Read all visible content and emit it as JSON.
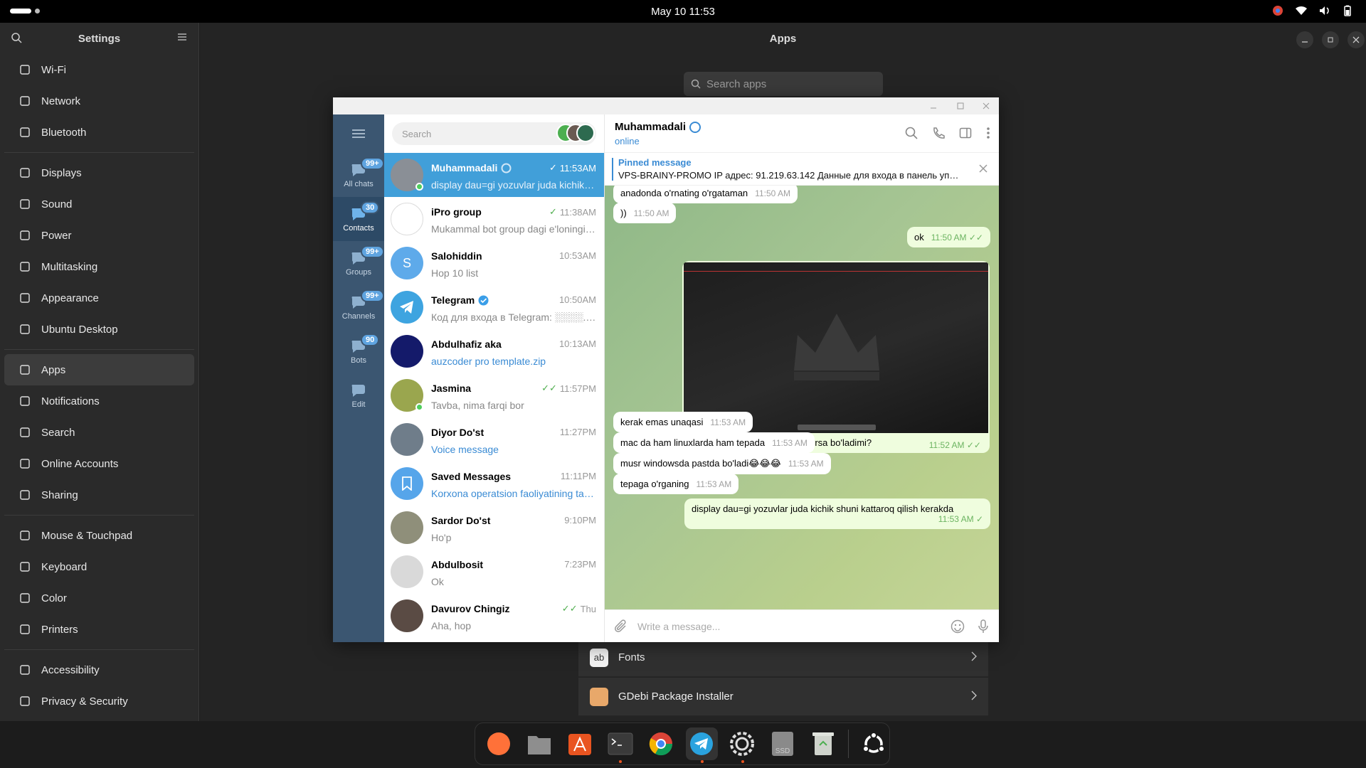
{
  "topbar": {
    "clock": "May 10  11:53"
  },
  "settings": {
    "title": "Settings",
    "groups": [
      [
        {
          "label": "Wi-Fi",
          "icon": "wifi-icon"
        },
        {
          "label": "Network",
          "icon": "network-icon"
        },
        {
          "label": "Bluetooth",
          "icon": "bluetooth-icon"
        }
      ],
      [
        {
          "label": "Displays",
          "icon": "display-icon"
        },
        {
          "label": "Sound",
          "icon": "sound-icon"
        },
        {
          "label": "Power",
          "icon": "power-icon"
        },
        {
          "label": "Multitasking",
          "icon": "multitasking-icon"
        },
        {
          "label": "Appearance",
          "icon": "appearance-icon"
        },
        {
          "label": "Ubuntu Desktop",
          "icon": "ubuntu-desktop-icon"
        }
      ],
      [
        {
          "label": "Apps",
          "icon": "apps-icon",
          "active": true
        },
        {
          "label": "Notifications",
          "icon": "notifications-icon"
        },
        {
          "label": "Search",
          "icon": "search-icon"
        },
        {
          "label": "Online Accounts",
          "icon": "cloud-icon"
        },
        {
          "label": "Sharing",
          "icon": "sharing-icon"
        }
      ],
      [
        {
          "label": "Mouse & Touchpad",
          "icon": "mouse-icon"
        },
        {
          "label": "Keyboard",
          "icon": "keyboard-icon"
        },
        {
          "label": "Color",
          "icon": "color-icon"
        },
        {
          "label": "Printers",
          "icon": "printer-icon"
        }
      ],
      [
        {
          "label": "Accessibility",
          "icon": "accessibility-icon"
        },
        {
          "label": "Privacy & Security",
          "icon": "privacy-icon"
        }
      ]
    ]
  },
  "apps": {
    "title": "Apps",
    "search_placeholder": "Search apps",
    "rows": [
      {
        "label": "Fonts",
        "color": "#f2f2f2"
      },
      {
        "label": "GDebi Package Installer",
        "color": "#e8a86a"
      }
    ]
  },
  "telegram": {
    "sidebar": [
      {
        "label": "All chats",
        "badge": "99+",
        "icon": "chats-icon"
      },
      {
        "label": "Contacts",
        "badge": "30",
        "icon": "contacts-icon",
        "active": true
      },
      {
        "label": "Groups",
        "badge": "99+",
        "icon": "groups-icon"
      },
      {
        "label": "Channels",
        "badge": "99+",
        "icon": "channels-icon"
      },
      {
        "label": "Bots",
        "badge": "90",
        "icon": "bots-icon"
      },
      {
        "label": "Edit",
        "badge": "",
        "icon": "edit-icon"
      }
    ],
    "search_placeholder": "Search",
    "chats": [
      {
        "name": "Muhammadali",
        "time": "11:53AM",
        "preview": "display dau=gi yozuvlar juda kichik shuni kattaroq qilish kerakda",
        "check": "single",
        "active": true,
        "avatar": "#8a8f96",
        "online": true,
        "badge_icon": true
      },
      {
        "name": "iPro group",
        "time": "11:38AM",
        "preview": "Mukammal bot group dagi e'loningizni",
        "check": "single",
        "avatar": "#ffffff",
        "sub_icon": true
      },
      {
        "name": "Salohiddin",
        "time": "10:53AM",
        "preview": "Hop 10 list",
        "avatar": "#5eaaea",
        "letter": "S"
      },
      {
        "name": "Telegram",
        "time": "10:50AM",
        "preview": "Код для входа в Telegram: ░░░░. Не давайте код",
        "verified": true,
        "avatar": "#3ea4e0"
      },
      {
        "name": "Abdulhafiz aka",
        "time": "10:13AM",
        "preview": "auzcoder pro template.zip",
        "blue": true,
        "avatar": "#141a6a"
      },
      {
        "name": "Jasmina",
        "time": "11:57PM",
        "preview": "Tavba, nima farqi bor",
        "check": "double",
        "avatar": "#9aa64e",
        "online": true
      },
      {
        "name": "Diyor Do'st",
        "time": "11:27PM",
        "preview": "Voice message",
        "blue": true,
        "avatar": "#6f7d8a"
      },
      {
        "name": "Saved Messages",
        "time": "11:11PM",
        "preview": "Korxona operatsion faoliyatining tahlili",
        "blue": true,
        "avatar": "#56a5ea",
        "saved": true
      },
      {
        "name": "Sardor Do'st",
        "time": "9:10PM",
        "preview": "Ho'p",
        "avatar": "#8f8f7a"
      },
      {
        "name": "Abdulbosit",
        "time": "7:23PM",
        "preview": "Ok",
        "avatar": "#d9d9d9"
      },
      {
        "name": "Davurov Chingiz",
        "time": "Thu",
        "preview": "Aha, hop",
        "check": "double",
        "avatar": "#5a4b44"
      }
    ],
    "conversation": {
      "name": "Muhammadali",
      "status": "online",
      "pinned_title": "Pinned message",
      "pinned_text": "VPS-BRAINY-PROMO  IP адрес: 91.219.63.142  Данные для входа в панель управления",
      "composer_placeholder": "Write a message...",
      "messages": [
        {
          "text": "anadonda o'rnating o'rgataman",
          "time": "11:50 AM",
          "dir": "in"
        },
        {
          "text": "))",
          "time": "11:50 AM",
          "dir": "in"
        },
        {
          "text": "ok",
          "time": "11:50 AM",
          "dir": "out"
        },
        {
          "text": "mashu tepadagini pastga tushirsa bo'ladimi?",
          "time": "11:52 AM",
          "dir": "out",
          "image": true
        },
        {
          "text": "kerak emas unaqasi",
          "time": "11:53 AM",
          "dir": "in"
        },
        {
          "text": "mac da ham linuxlarda ham tepada",
          "time": "11:53 AM",
          "dir": "in"
        },
        {
          "text": "musr windowsda pastda bo'ladi😂😂😂",
          "time": "11:53 AM",
          "dir": "in"
        },
        {
          "text": "tepaga o'rganing",
          "time": "11:53 AM",
          "dir": "in"
        },
        {
          "text": "display dau=gi yozuvlar juda kichik shuni kattaroq qilish kerakda",
          "time": "11:53 AM",
          "dir": "out"
        }
      ]
    }
  },
  "dock": [
    {
      "name": "firefox-icon",
      "color": "#ff7139"
    },
    {
      "name": "files-icon",
      "color": "#8e8e8e"
    },
    {
      "name": "app-center-icon",
      "color": "#e95420"
    },
    {
      "name": "terminal-icon",
      "color": "#3a3a3a",
      "running": true
    },
    {
      "name": "chrome-icon",
      "color": "#4285f4"
    },
    {
      "name": "telegram-icon",
      "color": "#2aa3df",
      "running": true,
      "active": true
    },
    {
      "name": "settings-icon",
      "color": "#7a7a7a",
      "running": true
    },
    {
      "name": "ssd-icon",
      "color": "#8a8a8a",
      "label": "SSD"
    },
    {
      "name": "trash-icon",
      "color": "#cfd3cc"
    },
    {
      "name": "ubuntu-logo-icon",
      "color": "#ffffff"
    }
  ]
}
